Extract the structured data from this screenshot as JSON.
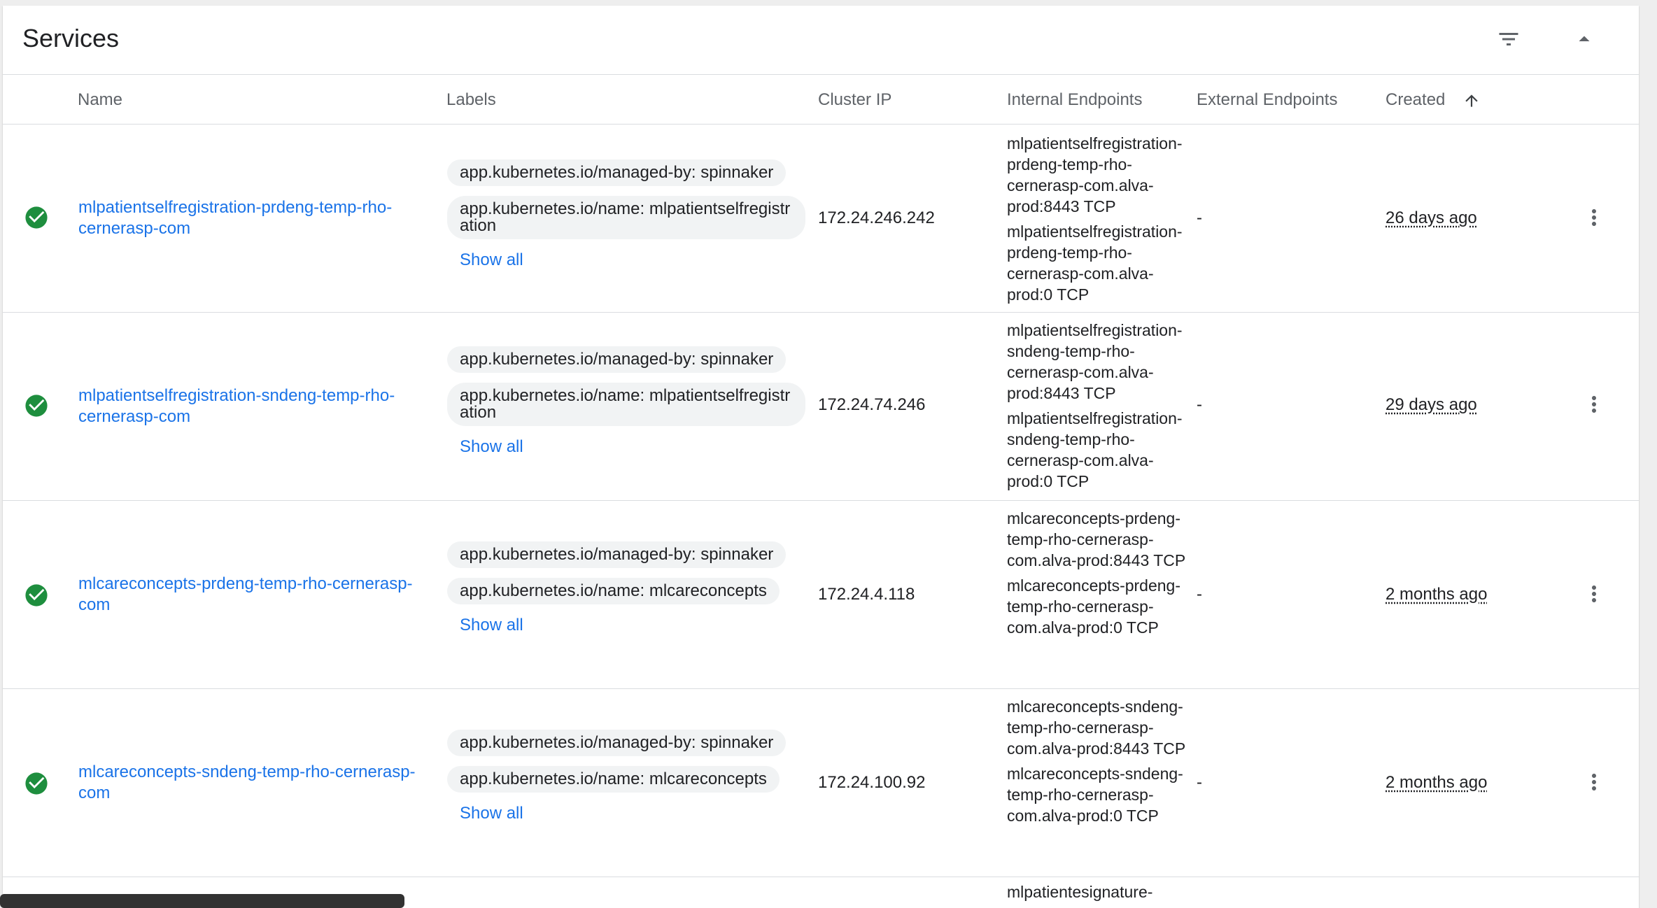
{
  "card": {
    "title": "Services",
    "filter_icon": "filter-list-icon",
    "collapse_icon": "arrow-drop-up-icon"
  },
  "columns": {
    "name": "Name",
    "labels": "Labels",
    "cluster_ip": "Cluster IP",
    "internal_endpoints": "Internal Endpoints",
    "external_endpoints": "External Endpoints",
    "created": "Created",
    "sort_icon": "arrow-upward-icon"
  },
  "colors": {
    "link": "#1a73e8",
    "status_ok": "#1e8e3e",
    "chip_bg": "#f1f3f4"
  },
  "rows": [
    {
      "status_icon": "check-circle-icon",
      "name": "mlpatientselfregistration-prdeng-temp-rho-cernerasp-com",
      "label1": "app.kubernetes.io/managed-by: spinnaker",
      "label2": "app.kubernetes.io/name: mlpatientselfregistration",
      "show_all": "Show all",
      "cluster_ip": "172.24.246.242",
      "ep1": "mlpatientselfregistration-prdeng-temp-rho-cernerasp-com.alva-prod:8443 TCP",
      "ep2": "mlpatientselfregistration-prdeng-temp-rho-cernerasp-com.alva-prod:0 TCP",
      "external": "-",
      "created": "26 days ago"
    },
    {
      "status_icon": "check-circle-icon",
      "name": "mlpatientselfregistration-sndeng-temp-rho-cernerasp-com",
      "label1": "app.kubernetes.io/managed-by: spinnaker",
      "label2": "app.kubernetes.io/name: mlpatientselfregistration",
      "show_all": "Show all",
      "cluster_ip": "172.24.74.246",
      "ep1": "mlpatientselfregistration-sndeng-temp-rho-cernerasp-com.alva-prod:8443 TCP",
      "ep2": "mlpatientselfregistration-sndeng-temp-rho-cernerasp-com.alva-prod:0 TCP",
      "external": "-",
      "created": "29 days ago"
    },
    {
      "status_icon": "check-circle-icon",
      "name": "mlcareconcepts-prdeng-temp-rho-cernerasp-com",
      "label1": "app.kubernetes.io/managed-by: spinnaker",
      "label2": "app.kubernetes.io/name: mlcareconcepts",
      "show_all": "Show all",
      "cluster_ip": "172.24.4.118",
      "ep1": "mlcareconcepts-prdeng-temp-rho-cernerasp-com.alva-prod:8443 TCP",
      "ep2": "mlcareconcepts-prdeng-temp-rho-cernerasp-com.alva-prod:0 TCP",
      "external": "-",
      "created": "2 months ago"
    },
    {
      "status_icon": "check-circle-icon",
      "name": "mlcareconcepts-sndeng-temp-rho-cernerasp-com",
      "label1": "app.kubernetes.io/managed-by: spinnaker",
      "label2": "app.kubernetes.io/name: mlcareconcepts",
      "show_all": "Show all",
      "cluster_ip": "172.24.100.92",
      "ep1": "mlcareconcepts-sndeng-temp-rho-cernerasp-com.alva-prod:8443 TCP",
      "ep2": "mlcareconcepts-sndeng-temp-rho-cernerasp-com.alva-prod:0 TCP",
      "external": "-",
      "created": "2 months ago"
    }
  ],
  "partial_row": {
    "ep_fragment": "mlpatientesignature-"
  }
}
